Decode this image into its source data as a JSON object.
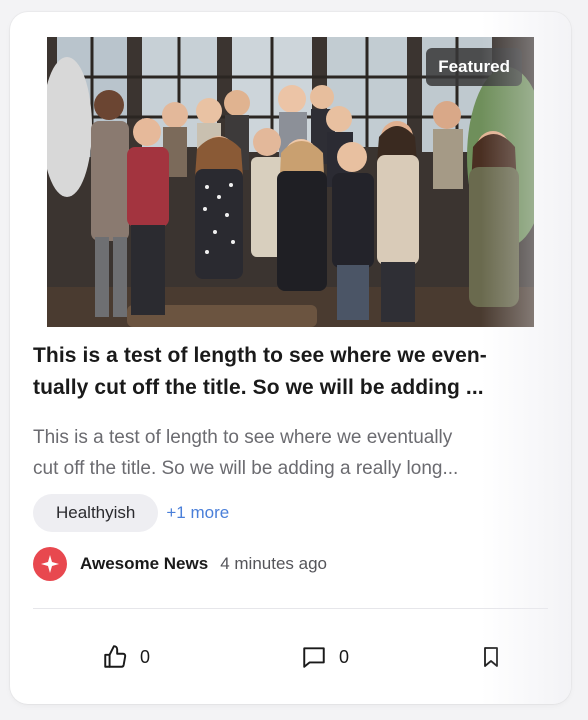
{
  "card": {
    "badge": "Featured",
    "image_alt": "Group photo of a team standing together in a room with large windows",
    "title_lines": [
      "This is a test of length to see where we even-",
      "tually cut off the title. So we will be adding ..."
    ],
    "summary_lines": [
      "This is a test of length to see where we eventually",
      "cut off the title. So we will be adding a really long..."
    ],
    "tags": {
      "primary": "Healthyish",
      "more": "+1 more"
    },
    "source": {
      "name": "Awesome News",
      "time": "4 minutes ago",
      "avatar_icon": "sparkle-icon",
      "avatar_color": "#e8484f"
    },
    "actions": {
      "likes": "0",
      "comments": "0",
      "like_icon": "thumbs-up-icon",
      "comment_icon": "comment-icon",
      "bookmark_icon": "bookmark-icon"
    }
  }
}
